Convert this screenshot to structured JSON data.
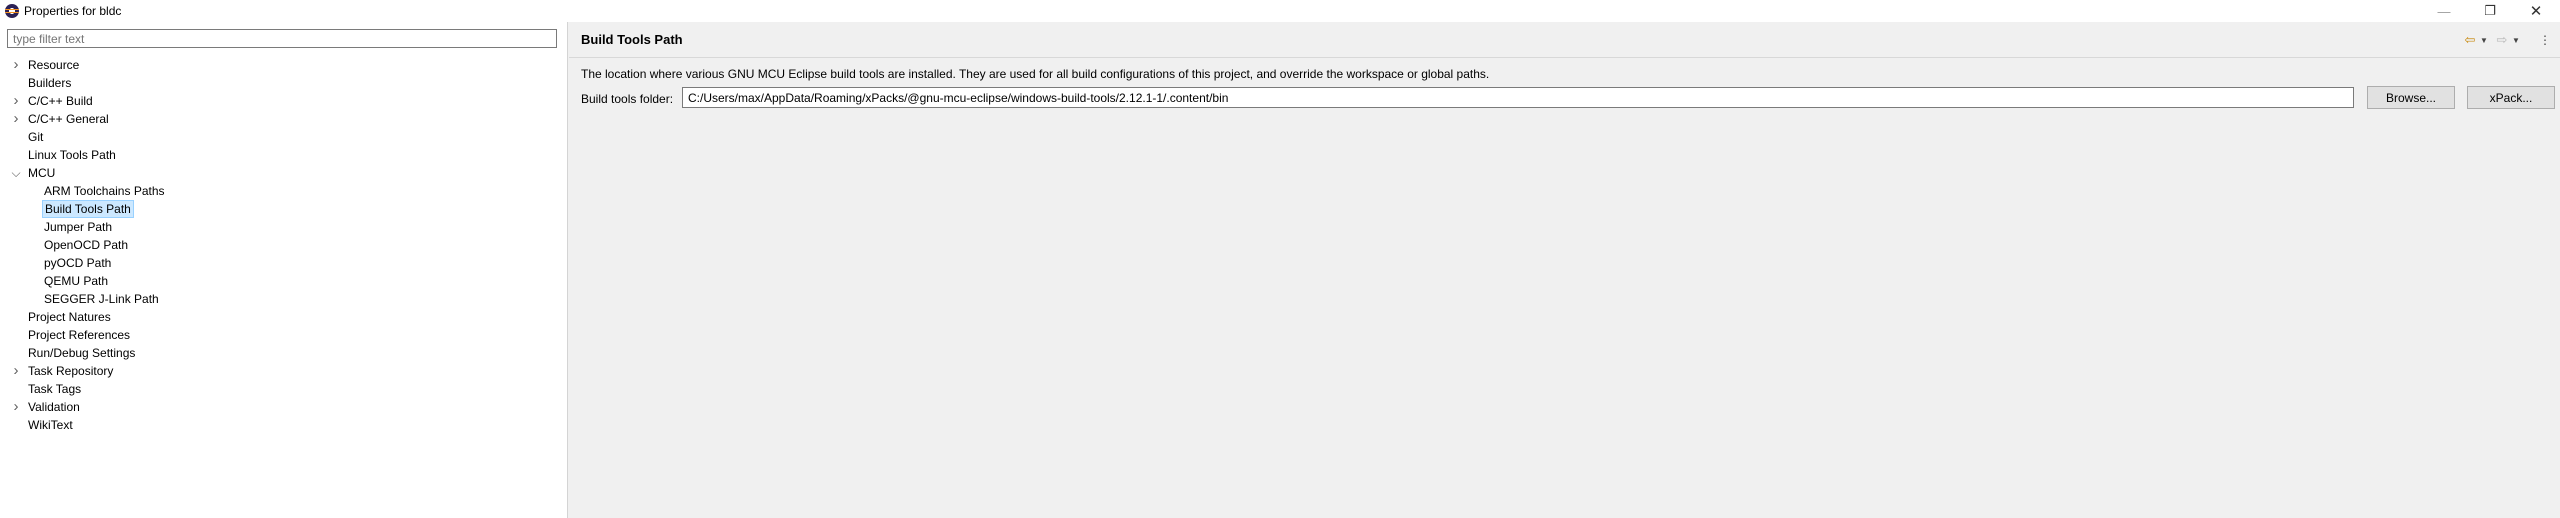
{
  "window": {
    "title": "Properties for bldc",
    "minimize_glyph": "—",
    "maximize_glyph": "❐",
    "close_glyph": "✕"
  },
  "sidebar": {
    "filter_placeholder": "type filter text",
    "filter_value": "",
    "items": [
      {
        "label": "Resource",
        "expandable": true,
        "expanded": false,
        "level": 0
      },
      {
        "label": "Builders",
        "expandable": false,
        "level": 0
      },
      {
        "label": "C/C++ Build",
        "expandable": true,
        "expanded": false,
        "level": 0
      },
      {
        "label": "C/C++ General",
        "expandable": true,
        "expanded": false,
        "level": 0
      },
      {
        "label": "Git",
        "expandable": false,
        "level": 0
      },
      {
        "label": "Linux Tools Path",
        "expandable": false,
        "level": 0
      },
      {
        "label": "MCU",
        "expandable": true,
        "expanded": true,
        "level": 0
      },
      {
        "label": "ARM Toolchains Paths",
        "expandable": false,
        "level": 1
      },
      {
        "label": "Build Tools Path",
        "expandable": false,
        "level": 1,
        "selected": true
      },
      {
        "label": "Jumper Path",
        "expandable": false,
        "level": 1
      },
      {
        "label": "OpenOCD Path",
        "expandable": false,
        "level": 1
      },
      {
        "label": "pyOCD Path",
        "expandable": false,
        "level": 1
      },
      {
        "label": "QEMU Path",
        "expandable": false,
        "level": 1
      },
      {
        "label": "SEGGER J-Link Path",
        "expandable": false,
        "level": 1
      },
      {
        "label": "Project Natures",
        "expandable": false,
        "level": 0
      },
      {
        "label": "Project References",
        "expandable": false,
        "level": 0
      },
      {
        "label": "Run/Debug Settings",
        "expandable": false,
        "level": 0
      },
      {
        "label": "Task Repository",
        "expandable": true,
        "expanded": false,
        "level": 0
      },
      {
        "label": "Task Tags",
        "expandable": false,
        "level": 0
      },
      {
        "label": "Validation",
        "expandable": true,
        "expanded": false,
        "level": 0
      },
      {
        "label": "WikiText",
        "expandable": false,
        "level": 0
      }
    ]
  },
  "page": {
    "title": "Build Tools Path",
    "description": "The location where various GNU MCU Eclipse build tools are installed. They are used for all build configurations of this project, and override the workspace or global paths.",
    "field_label": "Build tools folder:",
    "field_value": "C:/Users/max/AppData/Roaming/xPacks/@gnu-mcu-eclipse/windows-build-tools/2.12.1-1/.content/bin",
    "browse_label": "Browse...",
    "xpack_label": "xPack..."
  },
  "toolbar": {
    "back_icon": "back-arrow-icon",
    "forward_icon": "forward-arrow-icon",
    "menu_icon": "view-menu-icon"
  },
  "colors": {
    "selection_bg": "#cce8ff",
    "selection_border": "#99d1ff",
    "back_arrow": "#c88a10"
  }
}
